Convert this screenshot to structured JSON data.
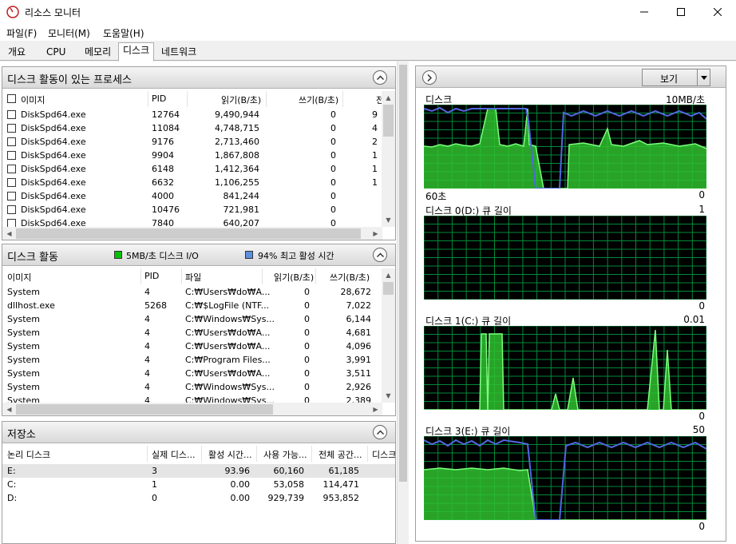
{
  "window": {
    "title": "리소스 모니터"
  },
  "menu": [
    "파일(F)",
    "모니터(M)",
    "도움말(H)"
  ],
  "tabs": [
    "개요",
    "CPU",
    "메모리",
    "디스크",
    "네트워크"
  ],
  "processes": {
    "title": "디스크 활동이 있는 프로세스",
    "columns": [
      "이미지",
      "PID",
      "읽기(B/초)",
      "쓰기(B/초)",
      "전"
    ],
    "rows": [
      {
        "image": "DiskSpd64.exe",
        "pid": "12764",
        "read": "9,490,944",
        "write": "0",
        "extra": "9"
      },
      {
        "image": "DiskSpd64.exe",
        "pid": "11084",
        "read": "4,748,715",
        "write": "0",
        "extra": "4"
      },
      {
        "image": "DiskSpd64.exe",
        "pid": "9176",
        "read": "2,713,460",
        "write": "0",
        "extra": "2"
      },
      {
        "image": "DiskSpd64.exe",
        "pid": "9904",
        "read": "1,867,808",
        "write": "0",
        "extra": "1"
      },
      {
        "image": "DiskSpd64.exe",
        "pid": "6148",
        "read": "1,412,364",
        "write": "0",
        "extra": "1"
      },
      {
        "image": "DiskSpd64.exe",
        "pid": "6632",
        "read": "1,106,255",
        "write": "0",
        "extra": "1"
      },
      {
        "image": "DiskSpd64.exe",
        "pid": "4000",
        "read": "841,244",
        "write": "0",
        "extra": ""
      },
      {
        "image": "DiskSpd64.exe",
        "pid": "10476",
        "read": "721,981",
        "write": "0",
        "extra": ""
      },
      {
        "image": "DiskSpd64.exe",
        "pid": "7840",
        "read": "640,207",
        "write": "0",
        "extra": ""
      }
    ]
  },
  "activity": {
    "title": "디스크 활동",
    "legend_io": "5MB/초 디스크 I/O",
    "legend_active": "94% 최고 활성 시간",
    "legend_io_color": "#00c000",
    "legend_active_color": "#5d8fe0",
    "columns": [
      "이미지",
      "PID",
      "파일",
      "읽기(B/초)",
      "쓰기(B/초)"
    ],
    "rows": [
      {
        "image": "System",
        "pid": "4",
        "file": "C:₩Users₩do₩A...",
        "read": "0",
        "write": "28,672"
      },
      {
        "image": "dllhost.exe",
        "pid": "5268",
        "file": "C:₩$LogFile (NTF...",
        "read": "0",
        "write": "7,022"
      },
      {
        "image": "System",
        "pid": "4",
        "file": "C:₩Windows₩Sys...",
        "read": "0",
        "write": "6,144"
      },
      {
        "image": "System",
        "pid": "4",
        "file": "C:₩Users₩do₩A...",
        "read": "0",
        "write": "4,681"
      },
      {
        "image": "System",
        "pid": "4",
        "file": "C:₩Users₩do₩A...",
        "read": "0",
        "write": "4,096"
      },
      {
        "image": "System",
        "pid": "4",
        "file": "C:₩Program Files...",
        "read": "0",
        "write": "3,991"
      },
      {
        "image": "System",
        "pid": "4",
        "file": "C:₩Users₩do₩A...",
        "read": "0",
        "write": "3,511"
      },
      {
        "image": "System",
        "pid": "4",
        "file": "C:₩Windows₩Sys...",
        "read": "0",
        "write": "2,926"
      },
      {
        "image": "System",
        "pid": "4",
        "file": "C:₩Windows₩Sys...",
        "read": "0",
        "write": "2,389"
      }
    ]
  },
  "storage": {
    "title": "저장소",
    "columns": [
      "논리 디스크",
      "실제 디스...",
      "활성 시간...",
      "사용 가능...",
      "전체 공간...",
      "디스크"
    ],
    "rows": [
      {
        "disk": "E:",
        "physical": "3",
        "active": "93.96",
        "free": "60,160",
        "total": "61,185"
      },
      {
        "disk": "C:",
        "physical": "1",
        "active": "0.00",
        "free": "53,058",
        "total": "114,471"
      },
      {
        "disk": "D:",
        "physical": "0",
        "active": "0.00",
        "free": "929,739",
        "total": "953,852"
      }
    ]
  },
  "right": {
    "view_label": "보기",
    "charts": [
      {
        "label": "디스크",
        "max": "10MB/초",
        "left_bottom": "60초",
        "min": "0"
      },
      {
        "label": "디스크 0(D:) 큐 길이",
        "max": "1",
        "min": "0"
      },
      {
        "label": "디스크 1(C:) 큐 길이",
        "max": "0.01",
        "min": "0"
      },
      {
        "label": "디스크 3(E:) 큐 길이",
        "max": "50",
        "min": "0"
      }
    ]
  },
  "colors": {
    "graph_bg": "#000000",
    "grid": "#008a3a",
    "fill": "#2fbf2f",
    "line_green": "#7cff7c",
    "line_blue": "#5068e0"
  }
}
